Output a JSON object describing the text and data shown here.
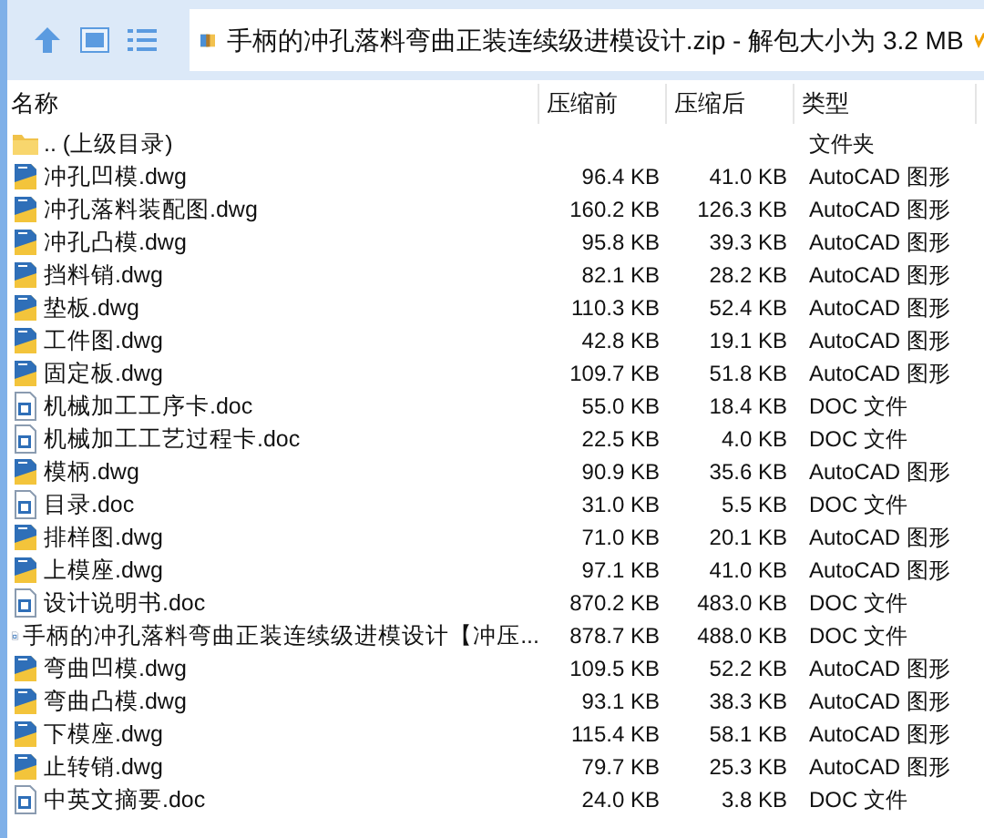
{
  "toolbar": {
    "address": "手柄的冲孔落料弯曲正装连续级进模设计.zip - 解包大小为 3.2 MB"
  },
  "table": {
    "columns": [
      "名称",
      "压缩前",
      "压缩后",
      "类型"
    ],
    "rows": [
      {
        "kind": "folder",
        "name": ".. (上级目录)",
        "type": "文件夹"
      },
      {
        "kind": "dwg",
        "name": "冲孔凹模.dwg",
        "size": "96.4 KB",
        "packed": "41.0 KB",
        "type": "AutoCAD 图形"
      },
      {
        "kind": "dwg",
        "name": "冲孔落料装配图.dwg",
        "size": "160.2 KB",
        "packed": "126.3 KB",
        "type": "AutoCAD 图形"
      },
      {
        "kind": "dwg",
        "name": "冲孔凸模.dwg",
        "size": "95.8 KB",
        "packed": "39.3 KB",
        "type": "AutoCAD 图形"
      },
      {
        "kind": "dwg",
        "name": "挡料销.dwg",
        "size": "82.1 KB",
        "packed": "28.2 KB",
        "type": "AutoCAD 图形"
      },
      {
        "kind": "dwg",
        "name": "垫板.dwg",
        "size": "110.3 KB",
        "packed": "52.4 KB",
        "type": "AutoCAD 图形"
      },
      {
        "kind": "dwg",
        "name": "工件图.dwg",
        "size": "42.8 KB",
        "packed": "19.1 KB",
        "type": "AutoCAD 图形"
      },
      {
        "kind": "dwg",
        "name": "固定板.dwg",
        "size": "109.7 KB",
        "packed": "51.8 KB",
        "type": "AutoCAD 图形"
      },
      {
        "kind": "doc",
        "name": "机械加工工序卡.doc",
        "size": "55.0 KB",
        "packed": "18.4 KB",
        "type": "DOC 文件"
      },
      {
        "kind": "doc",
        "name": "机械加工工艺过程卡.doc",
        "size": "22.5 KB",
        "packed": "4.0 KB",
        "type": "DOC 文件"
      },
      {
        "kind": "dwg",
        "name": "模柄.dwg",
        "size": "90.9 KB",
        "packed": "35.6 KB",
        "type": "AutoCAD 图形"
      },
      {
        "kind": "doc",
        "name": "目录.doc",
        "size": "31.0 KB",
        "packed": "5.5 KB",
        "type": "DOC 文件"
      },
      {
        "kind": "dwg",
        "name": "排样图.dwg",
        "size": "71.0 KB",
        "packed": "20.1 KB",
        "type": "AutoCAD 图形"
      },
      {
        "kind": "dwg",
        "name": "上模座.dwg",
        "size": "97.1 KB",
        "packed": "41.0 KB",
        "type": "AutoCAD 图形"
      },
      {
        "kind": "doc",
        "name": "设计说明书.doc",
        "size": "870.2 KB",
        "packed": "483.0 KB",
        "type": "DOC 文件"
      },
      {
        "kind": "doc",
        "name": "手柄的冲孔落料弯曲正装连续级进模设计【冲压...",
        "size": "878.7 KB",
        "packed": "488.0 KB",
        "type": "DOC 文件"
      },
      {
        "kind": "dwg",
        "name": "弯曲凹模.dwg",
        "size": "109.5 KB",
        "packed": "52.2 KB",
        "type": "AutoCAD 图形"
      },
      {
        "kind": "dwg",
        "name": "弯曲凸模.dwg",
        "size": "93.1 KB",
        "packed": "38.3 KB",
        "type": "AutoCAD 图形"
      },
      {
        "kind": "dwg",
        "name": "下模座.dwg",
        "size": "115.4 KB",
        "packed": "58.1 KB",
        "type": "AutoCAD 图形"
      },
      {
        "kind": "dwg",
        "name": "止转销.dwg",
        "size": "79.7 KB",
        "packed": "25.3 KB",
        "type": "AutoCAD 图形"
      },
      {
        "kind": "doc",
        "name": "中英文摘要.doc",
        "size": "24.0 KB",
        "packed": "3.8 KB",
        "type": "DOC 文件"
      }
    ]
  }
}
